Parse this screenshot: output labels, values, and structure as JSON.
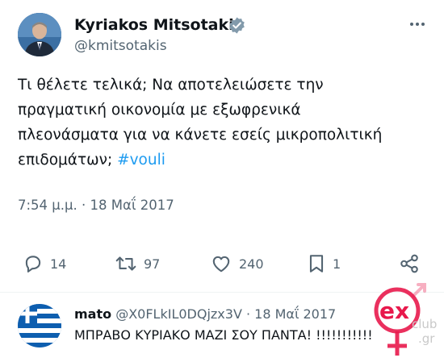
{
  "tweet": {
    "author_name": "Kyriakos Mitsotakis",
    "author_handle": "@kmitsotakis",
    "text_lines": [
      "Τι θέλετε τελικά; Να αποτελειώσετε την",
      "πραγματική οικονομία με εξωφρενικά",
      "πλεονάσματα για να κάνετε εσείς μικροπολιτική"
    ],
    "text_last_line": "επιδομάτων;",
    "hashtag": "#vouli",
    "timestamp": "7:54 μ.μ. · 18 Μαΐ 2017",
    "icons": {
      "avatar": "profile-avatar",
      "verified": "verified-badge-icon",
      "more": "more-options-icon"
    }
  },
  "actions": {
    "replies": "14",
    "retweets": "97",
    "likes": "240",
    "bookmarks": "1",
    "icons": [
      "reply-icon",
      "retweet-icon",
      "like-icon",
      "bookmark-icon",
      "share-icon"
    ]
  },
  "reply": {
    "author_name": "mato",
    "author_handle": "@X0FLkIL0DQjzx3V",
    "date": "18 Μαΐ 2017",
    "separator": "·",
    "text": "ΜΠΡΑΒΟ ΚΥΡΙΑΚΟ ΜΑΖΙ ΣΟΥ ΠΑΝΤΑ! !!!!!!!!!!!",
    "avatar": "greek-flag-avatar"
  },
  "watermark": {
    "text_ex": "ex",
    "text_club": "club",
    "text_gr": ".gr"
  },
  "colors": {
    "text": "#0f1419",
    "muted": "#536471",
    "accent": "#1d9bf0",
    "watermark": "#e8194c"
  }
}
